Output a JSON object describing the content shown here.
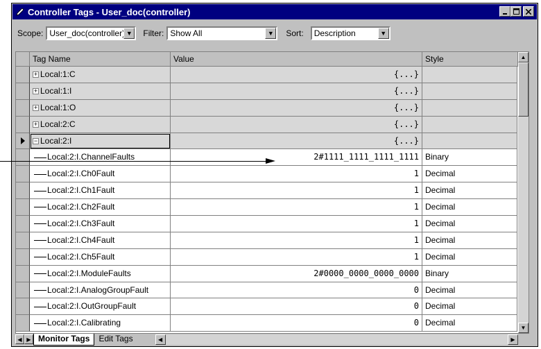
{
  "window": {
    "title": "Controller Tags - User_doc(controller)"
  },
  "toolbar": {
    "scope_label": "Scope:",
    "scope_value": "User_doc(controller)",
    "filter_label": "Filter:",
    "filter_value": "Show All",
    "sort_label": "Sort:",
    "sort_value": "Description"
  },
  "columns": {
    "name": "Tag Name",
    "value": "Value",
    "style": "Style"
  },
  "rows": [
    {
      "name": "Local:1:C",
      "value": "{...}",
      "style": "",
      "expander": "+"
    },
    {
      "name": "Local:1:I",
      "value": "{...}",
      "style": "",
      "expander": "+"
    },
    {
      "name": "Local:1:O",
      "value": "{...}",
      "style": "",
      "expander": "+"
    },
    {
      "name": "Local:2:C",
      "value": "{...}",
      "style": "",
      "expander": "+"
    },
    {
      "name": "Local:2:I",
      "value": "{...}",
      "style": "",
      "expander": "−"
    },
    {
      "name": "Local:2:I.ChannelFaults",
      "value": "2#1111_1111_1111_1111",
      "style": "Binary"
    },
    {
      "name": "Local:2:I.Ch0Fault",
      "value": "1",
      "style": "Decimal"
    },
    {
      "name": "Local:2:I.Ch1Fault",
      "value": "1",
      "style": "Decimal"
    },
    {
      "name": "Local:2:I.Ch2Fault",
      "value": "1",
      "style": "Decimal"
    },
    {
      "name": "Local:2:I.Ch3Fault",
      "value": "1",
      "style": "Decimal"
    },
    {
      "name": "Local:2:I.Ch4Fault",
      "value": "1",
      "style": "Decimal"
    },
    {
      "name": "Local:2:I.Ch5Fault",
      "value": "1",
      "style": "Decimal"
    },
    {
      "name": "Local:2:I.ModuleFaults",
      "value": "2#0000_0000_0000_0000",
      "style": "Binary"
    },
    {
      "name": "Local:2:I.AnalogGroupFault",
      "value": "0",
      "style": "Decimal"
    },
    {
      "name": "Local:2:I.OutGroupFault",
      "value": "0",
      "style": "Decimal"
    },
    {
      "name": "Local:2:I.Calibrating",
      "value": "0",
      "style": "Decimal"
    }
  ],
  "tabs": {
    "monitor": "Monitor Tags",
    "edit": "Edit Tags"
  }
}
